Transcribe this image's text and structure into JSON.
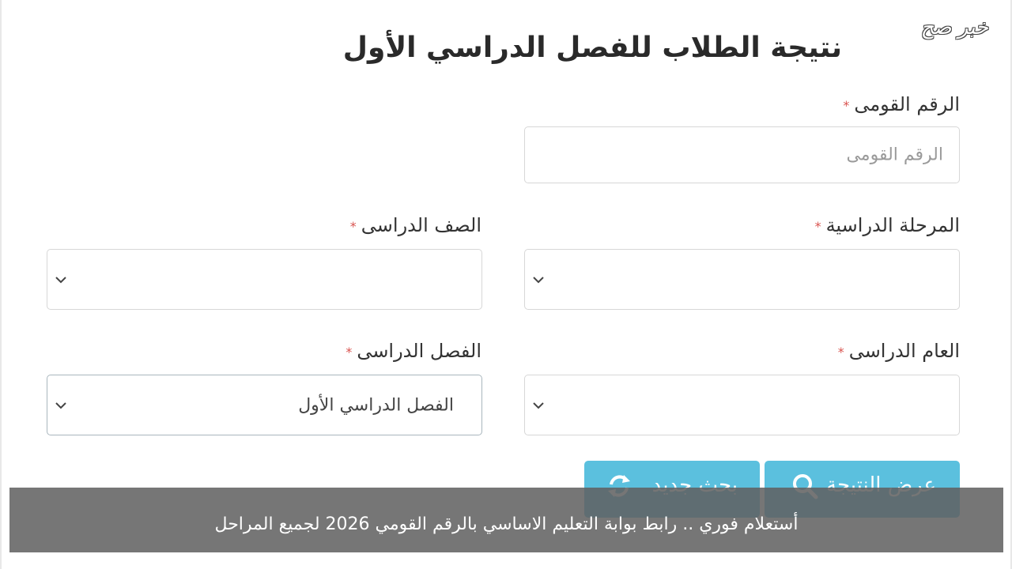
{
  "watermark": "خبر صح",
  "form": {
    "title": "نتيجة الطلاب للفصل الدراسي الأول",
    "required_marker": "*",
    "national_id": {
      "label": "الرقم القومى",
      "placeholder": "الرقم القومى",
      "value": ""
    },
    "stage": {
      "label": "المرحلة الدراسية",
      "value": ""
    },
    "grade": {
      "label": "الصف الدراسى",
      "value": ""
    },
    "year": {
      "label": "العام الدراسى",
      "value": ""
    },
    "term": {
      "label": "الفصل الدراسى",
      "value": "الفصل الدراسي الأول"
    }
  },
  "buttons": {
    "show_result": {
      "label": "عرض النتيجة",
      "icon": "search-icon"
    },
    "new_search": {
      "label": "بحث جديد",
      "icon": "refresh-icon"
    }
  },
  "caption": "أستعلام فوري .. رابط بوابة التعليم الاساسي بالرقم القومي 2026 لجميع المراحل",
  "colors": {
    "button": "#5bc0de",
    "required": "#d9534f",
    "caption_bg": "#5f5f5f"
  }
}
